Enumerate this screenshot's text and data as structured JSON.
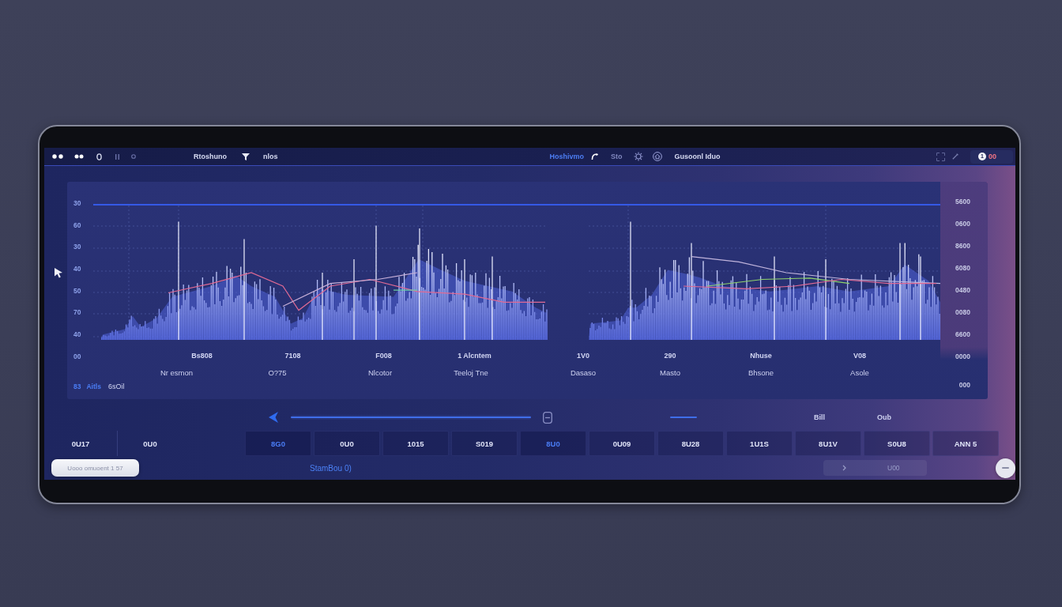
{
  "top_bar": {
    "title": "Rtoshuno",
    "filter_label": "nlos",
    "nav_link": "Hoshivmo",
    "nav_label": "Sto",
    "section_title": "Gusoonl Iduo",
    "notification": {
      "count": "1",
      "value": "00"
    }
  },
  "chart_panel": {
    "left_axis": [
      "30",
      "60",
      "30",
      "40",
      "50",
      "70",
      "40",
      "00"
    ],
    "charts": [
      {
        "x_labels": [
          "Bs808",
          "7108",
          "F008",
          "1 Alcntem"
        ],
        "captions": [
          "Nr esmon",
          "O?75",
          "Nlcotor",
          "Teeloj  Tne"
        ]
      },
      {
        "x_labels": [
          "1V0",
          "290",
          "Nhuse",
          "V08"
        ],
        "captions": [
          "Dasaso",
          "Masto",
          "Bhsone",
          "Asole"
        ]
      }
    ],
    "right_axis": [
      "5600",
      "0600",
      "8600",
      "6080",
      "0480",
      "0080",
      "6600",
      "0000",
      "000"
    ],
    "legend": {
      "key": "83",
      "label": "Aitls",
      "value": "6sOil"
    }
  },
  "transport": {
    "level": 1,
    "labels": [
      "Bill",
      "Oub"
    ]
  },
  "summary_cells": [
    "0U17",
    "0U0"
  ],
  "value_cells": [
    {
      "text": "8G0",
      "selected": true
    },
    {
      "text": "0U0",
      "selected": false
    },
    {
      "text": "1015",
      "selected": false
    },
    {
      "text": "S019",
      "selected": false
    },
    {
      "text": "8U0",
      "selected": true
    },
    {
      "text": "0U09",
      "selected": false
    },
    {
      "text": "8U28",
      "selected": false
    },
    {
      "text": "1U1S",
      "selected": false
    },
    {
      "text": "8U1V",
      "selected": false
    },
    {
      "text": "S0U8",
      "selected": false
    },
    {
      "text": "ANN 5",
      "selected": false
    }
  ],
  "footer": {
    "pill_label": "Uooo omuoent 1  57",
    "status": "StamBou 0)",
    "secondary_button": {
      "label": "U00",
      "disabled": true
    }
  }
}
